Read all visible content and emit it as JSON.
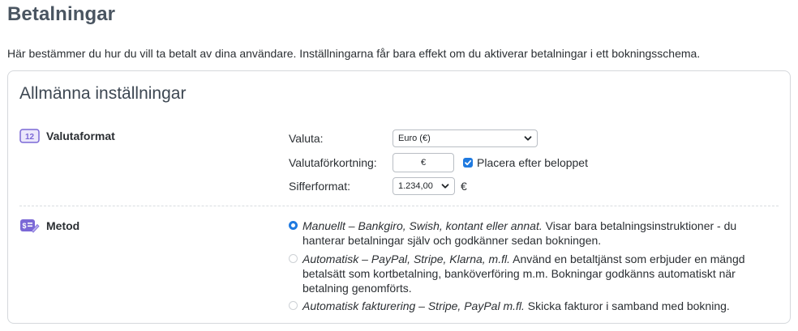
{
  "page": {
    "title": "Betalningar",
    "description": "Här bestämmer du hur du vill ta betalt av dina användare. Inställningarna får bara effekt om du aktiverar betalningar i ett bokningsschema."
  },
  "general_settings": {
    "title": "Allmänna inställningar",
    "currency_section": {
      "label": "Valutaformat",
      "icon": "number-12-icon",
      "currency": {
        "label": "Valuta:",
        "selected": "Euro (€)"
      },
      "abbreviation": {
        "label": "Valutaförkortning:",
        "value": "€",
        "checkbox_label": "Placera efter beloppet",
        "checkbox_checked": true
      },
      "number_format": {
        "label": "Sifferformat:",
        "selected": "1.234,00",
        "suffix": "€"
      }
    },
    "method_section": {
      "label": "Metod",
      "icon": "payment-method-icon",
      "options": [
        {
          "title": "Manuellt – Bankgiro, Swish, kontant eller annat.",
          "description": "Visar bara betalningsinstruktioner - du hanterar betalningar själv och godkänner sedan bokningen.",
          "selected": true
        },
        {
          "title": "Automatisk – PayPal, Stripe, Klarna, m.fl.",
          "description": "Använd en betaltjänst som erbjuder en mängd betalsätt som kortbetalning, banköverföring m.m. Bokningar godkänns automatiskt när betalning genomförts.",
          "selected": false
        },
        {
          "title": "Automatisk fakturering – Stripe, PayPal m.fl.",
          "description": "Skicka fakturor i samband med bokning.",
          "selected": false
        }
      ]
    }
  },
  "colors": {
    "accent": "#1f7ae0",
    "icon_purple": "#7b68d6",
    "title": "#4a5561"
  }
}
